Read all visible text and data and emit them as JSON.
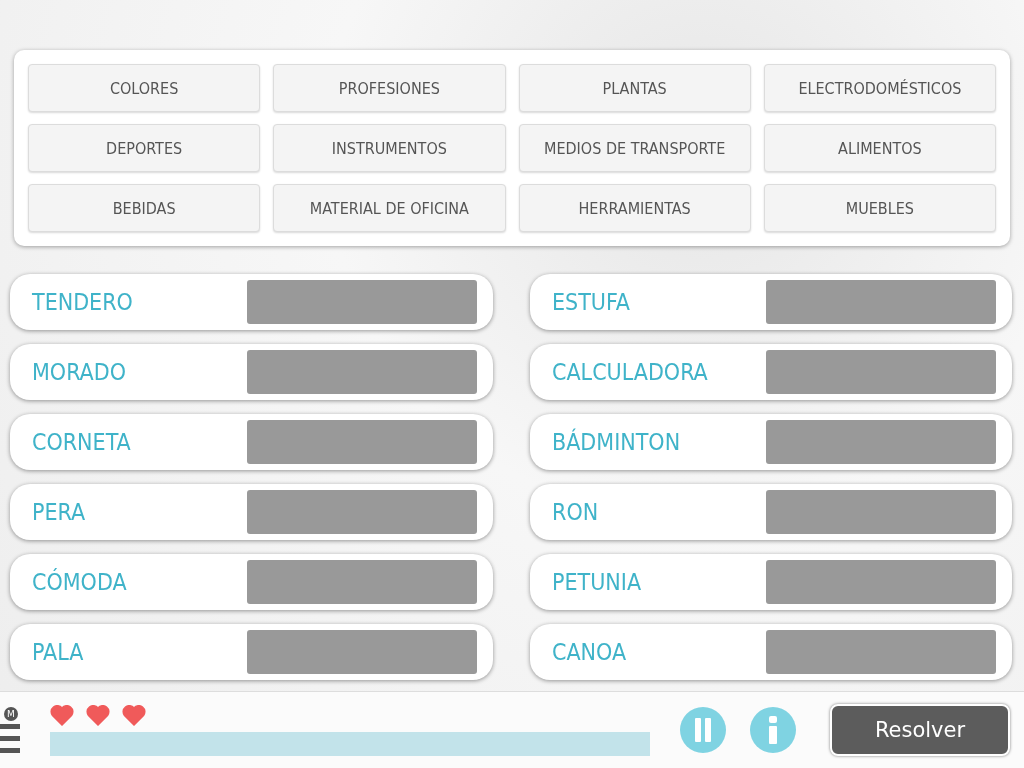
{
  "categories": [
    {
      "label": "COLORES"
    },
    {
      "label": "PROFESIONES"
    },
    {
      "label": "PLANTAS"
    },
    {
      "label": "ELECTRODOMÉSTICOS"
    },
    {
      "label": "DEPORTES"
    },
    {
      "label": "INSTRUMENTOS"
    },
    {
      "label": "MEDIOS DE TRANSPORTE"
    },
    {
      "label": "ALIMENTOS"
    },
    {
      "label": "BEBIDAS"
    },
    {
      "label": "MATERIAL DE OFICINA"
    },
    {
      "label": "HERRAMIENTAS"
    },
    {
      "label": "MUEBLES"
    }
  ],
  "words": [
    {
      "word": "TENDERO"
    },
    {
      "word": "ESTUFA"
    },
    {
      "word": "MORADO"
    },
    {
      "word": "CALCULADORA"
    },
    {
      "word": "CORNETA"
    },
    {
      "word": "BÁDMINTON"
    },
    {
      "word": "PERA"
    },
    {
      "word": "RON"
    },
    {
      "word": "CÓMODA"
    },
    {
      "word": "PETUNIA"
    },
    {
      "word": "PALA"
    },
    {
      "word": "CANOA"
    }
  ],
  "footer": {
    "menu_badge": "M",
    "hearts": [
      {
        "filled": true
      },
      {
        "filled": true
      },
      {
        "filled": true
      }
    ],
    "timer": {
      "level": 1
    },
    "solve_button": "Resolver"
  }
}
